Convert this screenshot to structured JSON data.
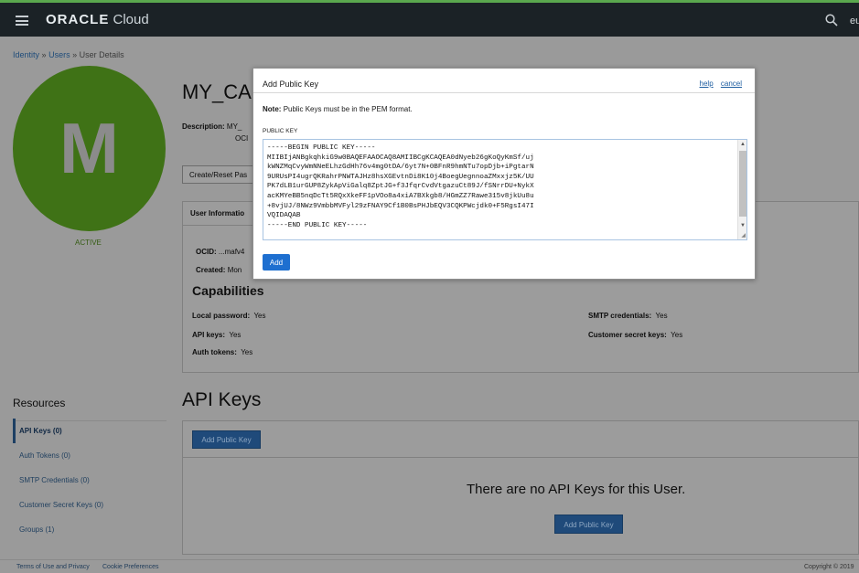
{
  "header": {
    "logo_brand": "ORACLE",
    "logo_product": "Cloud",
    "region_text": "eu"
  },
  "breadcrumb": {
    "items": [
      "Identity",
      "Users",
      "User Details"
    ],
    "separator": "»"
  },
  "user": {
    "avatar_letter": "M",
    "status": "ACTIVE",
    "title": "MY_CA",
    "description_label": "Description:",
    "description_value": "MY_",
    "description_line2": "OCI",
    "reset_button": "Create/Reset Pas"
  },
  "info_panel": {
    "tab_label": "User Informatio",
    "ocid_label": "OCID:",
    "ocid_value": "...mafv4",
    "created_label": "Created:",
    "created_value": "Mon",
    "capabilities_title": "Capabilities",
    "capabilities": [
      {
        "label": "Local password:",
        "value": "Yes"
      },
      {
        "label": "API keys:",
        "value": "Yes"
      },
      {
        "label": "Auth tokens:",
        "value": "Yes"
      },
      {
        "label": "SMTP credentials:",
        "value": "Yes"
      },
      {
        "label": "Customer secret keys:",
        "value": "Yes"
      }
    ]
  },
  "resources": {
    "title": "Resources",
    "items": [
      {
        "label": "API Keys (0)",
        "active": true
      },
      {
        "label": "Auth Tokens (0)",
        "active": false
      },
      {
        "label": "SMTP Credentials (0)",
        "active": false
      },
      {
        "label": "Customer Secret Keys (0)",
        "active": false
      },
      {
        "label": "Groups (1)",
        "active": false
      }
    ]
  },
  "api_keys": {
    "title": "API Keys",
    "add_button": "Add Public Key",
    "empty_message": "There are no API Keys for this User.",
    "empty_add_button": "Add Public Key"
  },
  "footer": {
    "terms": "Terms of Use and Privacy",
    "cookies": "Cookie Preferences",
    "copyright": "Copyright © 2019"
  },
  "modal": {
    "title": "Add Public Key",
    "help_link": "help",
    "cancel_link": "cancel",
    "note_label": "Note:",
    "note_text": "Public Keys must be in the PEM format.",
    "field_label": "PUBLIC KEY",
    "key_value": "-----BEGIN PUBLIC KEY-----\nMIIBIjANBgkqhkiG9w0BAQEFAAOCAQ8AMIIBCgKCAQEA0dNyeb26gKoQyKmSf/uj\nkWNZMqCvyWmNNeELhzGdHh76v4mg0tDA/6yt7N+0BFnR9hmNTu7opDjb+iPgtarN\n9URUsPI4ugrQKRahrPNWTAJHz8hsXGEvtnDi8K10j4BoegUegnnoaZMxxjz5K/UU\nPK7dLB1urGUP8ZykApViGalq8ZptJG+f3JfqrCvdVtgazuCt89J/fSNrrDU+NykX\nacKMYeBB5nqDcTt5RQxXkeFF1pVOo8a4xiA7BXkgb8/HGmZZ7Rawe315v8jkUu8u\n+8vjUJ/8NWz9VmbbMVFyl29zFNAY9Cf1B0BsPHJbEQV3CQKPWcjdk0+F5RgsI47I\nVQIDAQAB\n-----END PUBLIC KEY-----",
    "submit_button": "Add"
  }
}
